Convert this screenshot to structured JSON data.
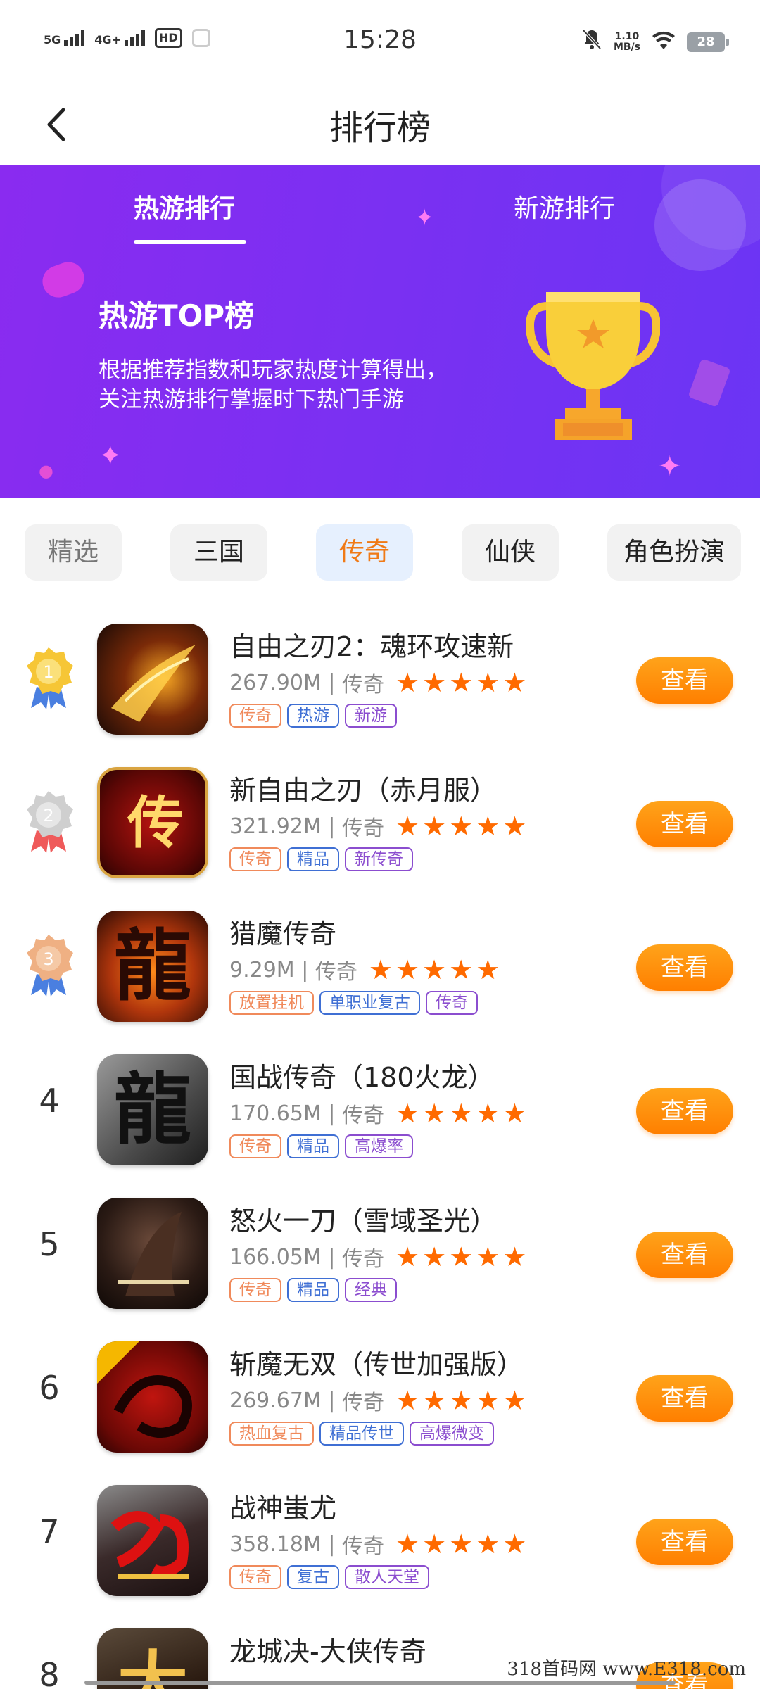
{
  "status_bar": {
    "sig1_label": "5G",
    "sig2_label": "4G+",
    "hd_label": "HD",
    "time": "15:28",
    "net_speed_value": "1.10",
    "net_speed_unit": "MB/s",
    "battery": "28"
  },
  "header": {
    "title": "排行榜"
  },
  "hero": {
    "tabs": [
      "热游排行",
      "新游排行"
    ],
    "active_tab": 0,
    "title": "热游TOP榜",
    "desc_line1": "根据推荐指数和玩家热度计算得出，",
    "desc_line2": "关注热游排行掌握时下热门手游"
  },
  "categories": [
    "精选",
    "三国",
    "传奇",
    "仙侠",
    "角色扮演"
  ],
  "active_category": 2,
  "view_label": "查看",
  "games": [
    {
      "rank": "1",
      "name": "自由之刃2：魂环攻速新",
      "size": "267.90M",
      "genre": "传奇",
      "tags": [
        "传奇",
        "热游",
        "新游"
      ],
      "stars": 5
    },
    {
      "rank": "2",
      "name": "新自由之刃（赤月服）",
      "size": "321.92M",
      "genre": "传奇",
      "tags": [
        "传奇",
        "精品",
        "新传奇"
      ],
      "stars": 5
    },
    {
      "rank": "3",
      "name": "猎魔传奇",
      "size": "9.29M",
      "genre": "传奇",
      "tags": [
        "放置挂机",
        "单职业复古",
        "传奇"
      ],
      "stars": 5
    },
    {
      "rank": "4",
      "name": "国战传奇（180火龙）",
      "size": "170.65M",
      "genre": "传奇",
      "tags": [
        "传奇",
        "精品",
        "高爆率"
      ],
      "stars": 5
    },
    {
      "rank": "5",
      "name": "怒火一刀（雪域圣光）",
      "size": "166.05M",
      "genre": "传奇",
      "tags": [
        "传奇",
        "精品",
        "经典"
      ],
      "stars": 5
    },
    {
      "rank": "6",
      "name": "斩魔无双（传世加强版）",
      "size": "269.67M",
      "genre": "传奇",
      "tags": [
        "热血复古",
        "精品传世",
        "高爆微变"
      ],
      "stars": 5
    },
    {
      "rank": "7",
      "name": "战神蚩尤",
      "size": "358.18M",
      "genre": "传奇",
      "tags": [
        "传奇",
        "复古",
        "散人天堂"
      ],
      "stars": 5
    },
    {
      "rank": "8",
      "name": "龙城决-大侠传奇",
      "size": "",
      "genre": "",
      "tags": [],
      "stars": 0
    }
  ],
  "watermark": "318首码网 www.E318.com",
  "colors": {
    "hero_bg": "#7a30f2",
    "accent_orange": "#ff7f00",
    "active_chip_bg": "#e6f0fe",
    "tag_orange": "#f08a5b",
    "tag_blue": "#3f6fd4",
    "tag_purple": "#8b4dcf",
    "star": "#ff6a00",
    "medal_gold": "#f6c636",
    "medal_silver": "#cfcfcf",
    "medal_bronze": "#efb083"
  }
}
